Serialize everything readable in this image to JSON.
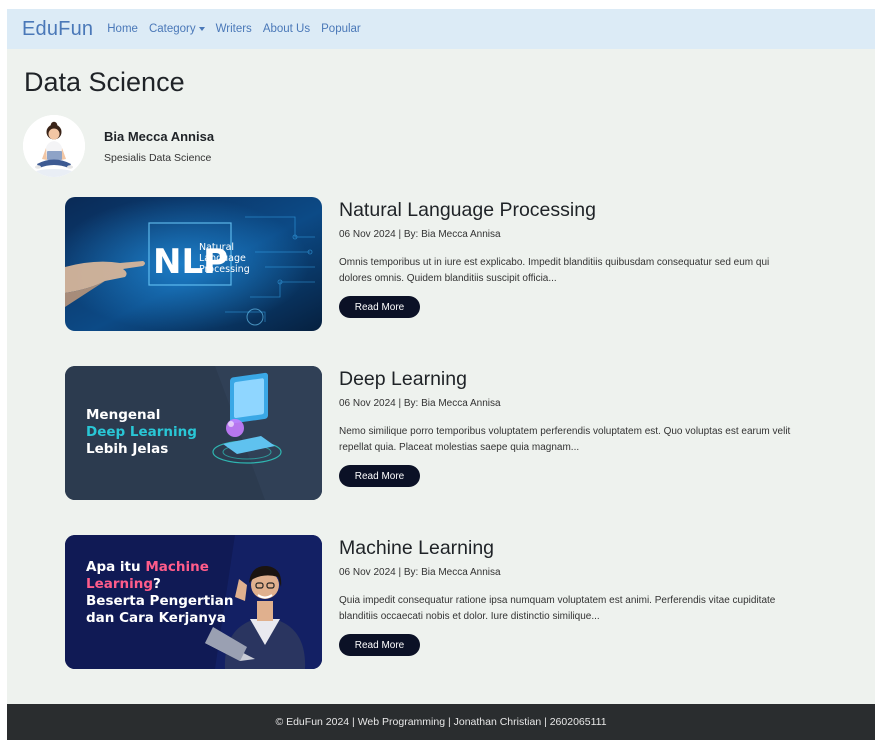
{
  "navbar": {
    "brand": "EduFun",
    "links": [
      "Home",
      "Category",
      "Writers",
      "About Us",
      "Popular"
    ]
  },
  "page": {
    "title": "Data Science"
  },
  "author": {
    "name": "Bia Mecca Annisa",
    "role": "Spesialis Data Science"
  },
  "articles": [
    {
      "title": "Natural Language Processing",
      "meta": "06 Nov 2024 | By: Bia Mecca Annisa",
      "excerpt": "Omnis temporibus ut in iure est explicabo. Impedit blanditiis quibusdam consequatur sed eum qui dolores omnis. Quidem blanditiis suscipit officia...",
      "button": "Read More",
      "thumb": {
        "big": "NLP",
        "lines": [
          "Natural",
          "Language",
          "Processing"
        ]
      }
    },
    {
      "title": "Deep Learning",
      "meta": "06 Nov 2024 | By: Bia Mecca Annisa",
      "excerpt": "Nemo similique porro temporibus voluptatem perferendis voluptatem est. Quo voluptas est earum velit repellat quia. Placeat molestias saepe quia magnam...",
      "button": "Read More",
      "thumb": {
        "lines": [
          "Mengenal",
          "Deep Learning",
          "Lebih Jelas"
        ]
      }
    },
    {
      "title": "Machine Learning",
      "meta": "06 Nov 2024 | By: Bia Mecca Annisa",
      "excerpt": "Quia impedit consequatur ratione ipsa numquam voluptatem est animi. Perferendis vitae cupiditate blanditiis occaecati nobis et dolor. Iure distinctio similique...",
      "button": "Read More",
      "thumb": {
        "line1a": "Apa itu ",
        "line1b": "Machine",
        "line2a": "Learning",
        "line2b": "?",
        "line3": "Beserta Pengertian",
        "line4": "dan Cara Kerjanya"
      }
    }
  ],
  "footer": {
    "text": "© EduFun 2024 | Web Programming | Jonathan Christian | 2602065111"
  },
  "colors": {
    "navbar": "#dcebf6",
    "link": "#4a78b8",
    "page_bg": "#eef2ee",
    "button": "#0b1126",
    "footer": "#2a2d2f",
    "accent_teal": "#29c7d6",
    "accent_pink": "#ff5c8a"
  }
}
